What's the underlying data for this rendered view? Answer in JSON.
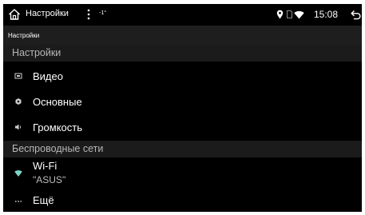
{
  "statusbar": {
    "app_title": "Настройки",
    "temperature": "-1°",
    "time": "15:08",
    "icons": [
      "home-icon",
      "more-vert-icon",
      "location-pin-icon",
      "sim-card-icon",
      "wifi-signal-icon",
      "back-icon"
    ]
  },
  "header": {
    "title": "Настройки"
  },
  "settings_section": {
    "label": "Настройки",
    "items": [
      {
        "label": "Видео",
        "icon": "video-icon"
      },
      {
        "label": "Основные",
        "icon": "general-settings-icon"
      },
      {
        "label": "Громкость",
        "icon": "volume-icon"
      }
    ]
  },
  "wireless_section": {
    "label": "Беспроводные сети",
    "items": [
      {
        "label": "Wi-Fi",
        "subtitle": "\"ASUS\"",
        "icon": "wifi-icon"
      },
      {
        "label": "Ещё",
        "icon": "more-horizontal-icon"
      }
    ]
  },
  "colors": {
    "background": "#000000",
    "header_bar": "#1e1e1e",
    "section_bar": "#1b1b1b",
    "wifi_accent": "#7fd6c6"
  }
}
